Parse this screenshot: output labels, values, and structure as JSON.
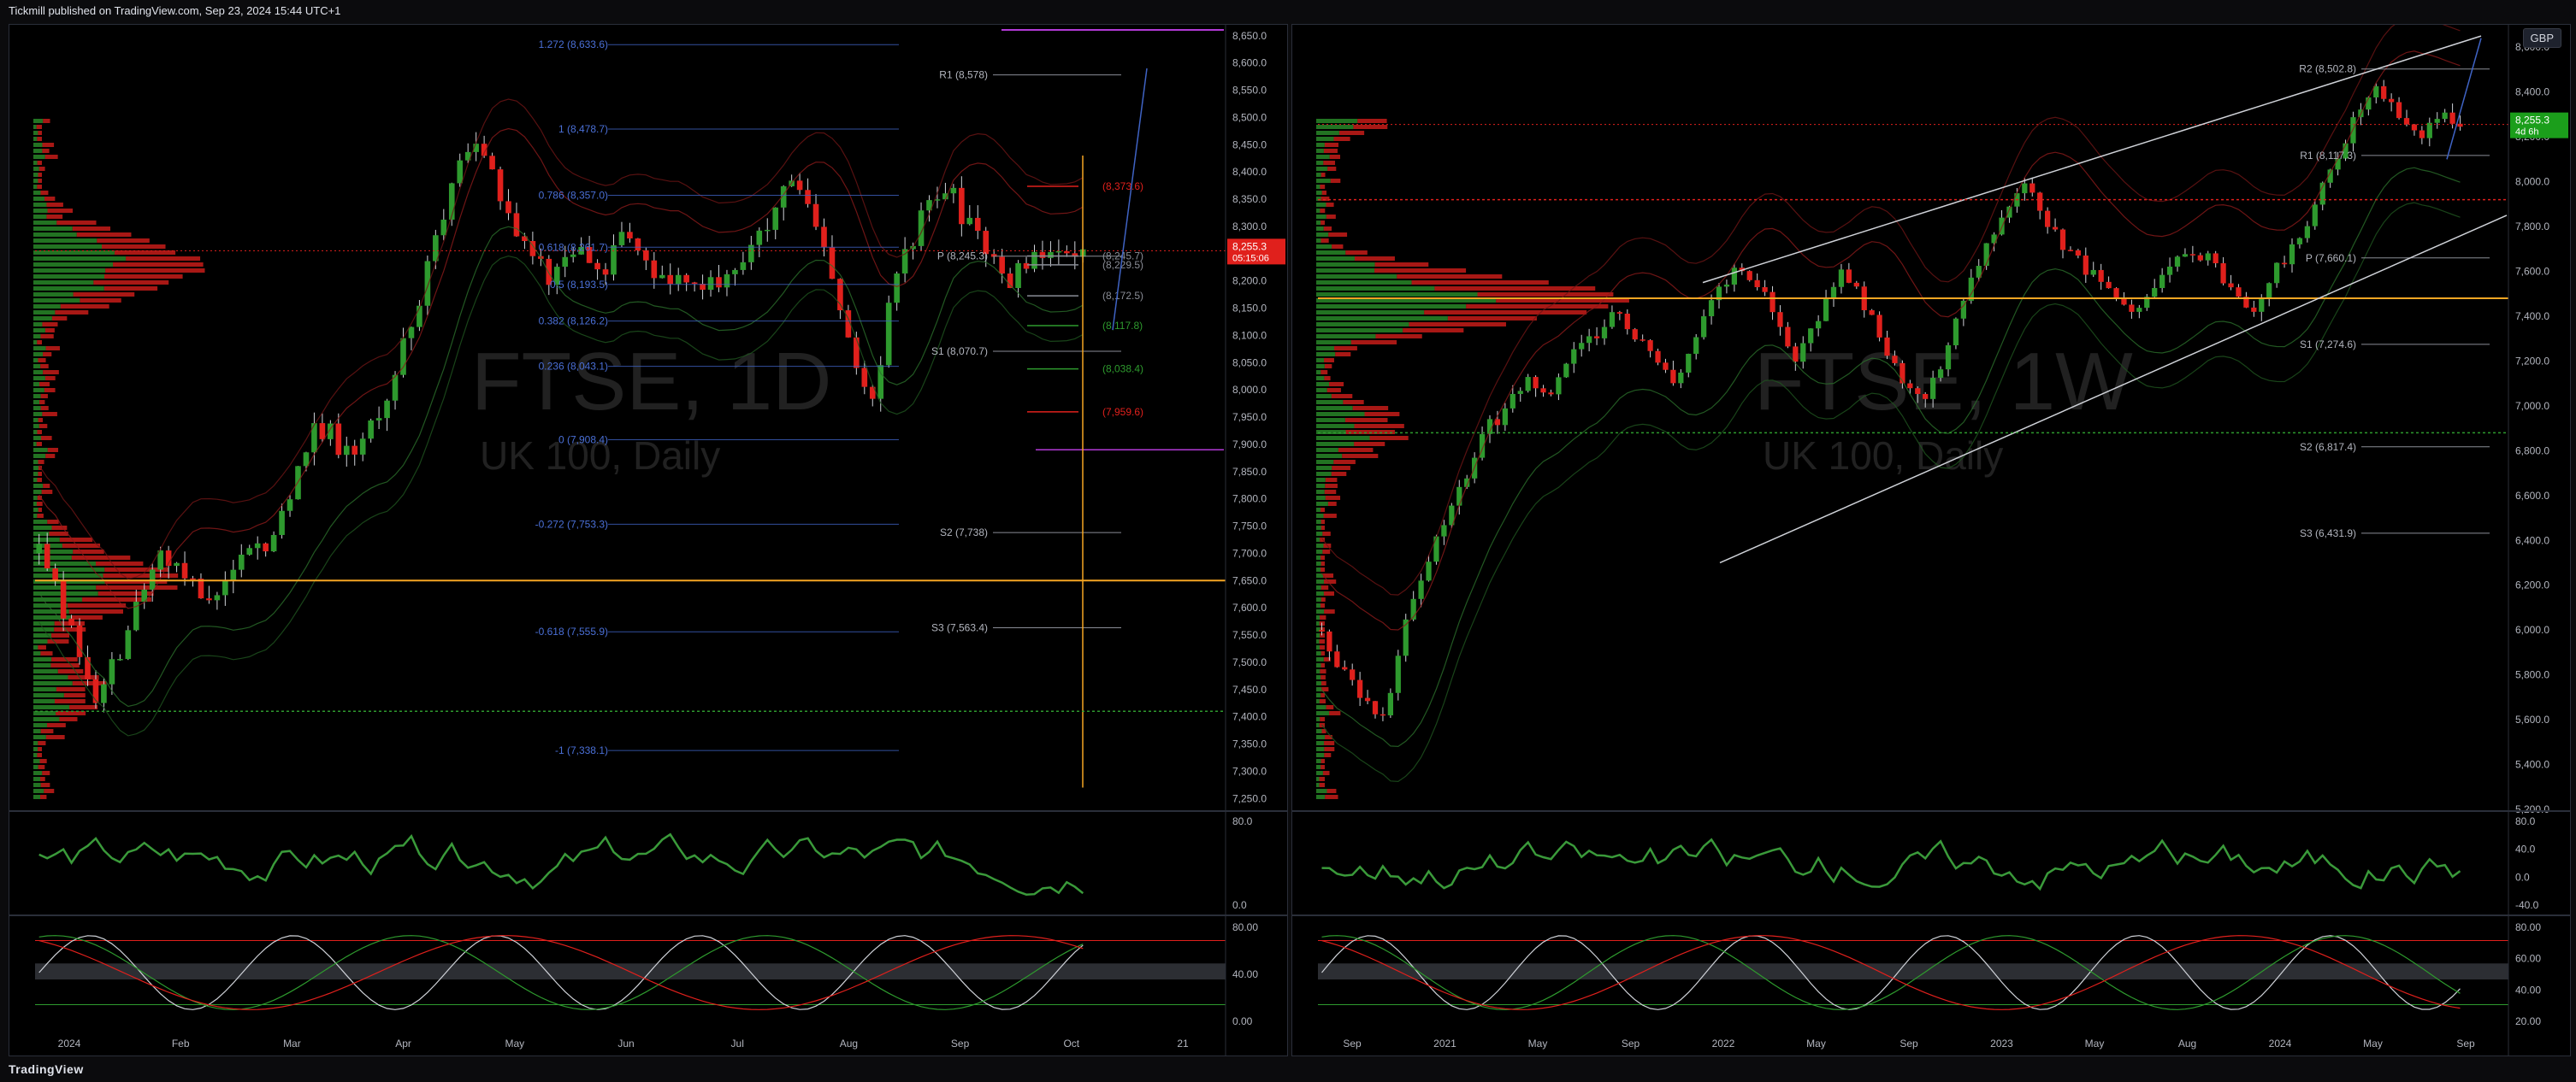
{
  "header": {
    "publisher_line": "Tickmill published on TradingView.com, Sep 23, 2024 15:44 UTC+1"
  },
  "footer": {
    "logo_text": "TradingView"
  },
  "colors": {
    "up": "#2e9a2e",
    "down": "#e0201c",
    "orange": "#f5a623",
    "fib_blue": "#3f63c4",
    "purple": "#b23ad6",
    "grid": "#1a1d24"
  },
  "left_chart": {
    "watermark_symbol": "FTSE, 1D",
    "watermark_desc": "UK 100, Daily",
    "price_axis": [
      "8,650.0",
      "8,600.0",
      "8,550.0",
      "8,500.0",
      "8,450.0",
      "8,400.0",
      "8,350.0",
      "8,300.0",
      "8,250.0",
      "8,200.0",
      "8,150.0",
      "8,100.0",
      "8,050.0",
      "8,000.0",
      "7,950.0",
      "7,900.0",
      "7,850.0",
      "7,800.0",
      "7,750.0",
      "7,700.0",
      "7,650.0",
      "7,600.0",
      "7,550.0",
      "7,500.0",
      "7,450.0",
      "7,400.0",
      "7,350.0",
      "7,300.0",
      "7,250.0"
    ],
    "time_axis": [
      "2024",
      "Feb",
      "Mar",
      "Apr",
      "May",
      "Jun",
      "Jul",
      "Aug",
      "Sep",
      "Oct",
      "21"
    ],
    "current_price": "8,255.3",
    "countdown": "05:15:06",
    "fib_labels": [
      "1.272 (8,633.6)",
      "1 (8,478.7)",
      "0.786 (8,357.0)",
      "0.618 (8,261.7)",
      "0.5 (8,193.5)",
      "0.382 (8,126.2)",
      "0.236 (8,043.1)",
      "0 (7,908.4)",
      "-0.272 (7,753.3)",
      "-0.618 (7,555.9)",
      "-1 (7,338.1)"
    ],
    "pivot_labels": [
      "R1 (8,578)",
      "P (8,245.3)",
      "S1 (8,070.7)",
      "S2 (7,738)",
      "S3 (7,563.4)"
    ],
    "level_labels": [
      "(8,373.6)",
      "(8,245.7)",
      "(8,229.5)",
      "(8,172.5)",
      "(8,117.8)",
      "(8,038.4)",
      "(7,959.6)"
    ],
    "osc1_axis": [
      "80.0",
      "0.0"
    ],
    "osc2_axis": [
      "80.00",
      "40.00",
      "0.00"
    ]
  },
  "right_chart": {
    "watermark_symbol": "FTSE, 1W",
    "watermark_desc": "UK 100, Daily",
    "currency_button": "GBP",
    "price_axis": [
      "8,600.0",
      "8,400.0",
      "8,200.0",
      "8,000.0",
      "7,800.0",
      "7,600.0",
      "7,400.0",
      "7,200.0",
      "7,000.0",
      "6,800.0",
      "6,600.0",
      "6,400.0",
      "6,200.0",
      "6,000.0",
      "5,800.0",
      "5,600.0",
      "5,400.0",
      "5,200.0"
    ],
    "time_axis": [
      "Sep",
      "2021",
      "May",
      "Sep",
      "2022",
      "May",
      "Sep",
      "2023",
      "May",
      "Aug",
      "2024",
      "May",
      "Sep"
    ],
    "current_price": "8,255.3",
    "countdown": "4d 6h",
    "pivot_labels": [
      "R2 (8,502.8)",
      "R1 (8,117.3)",
      "P (7,660.1)",
      "S1 (7,274.6)",
      "S2 (6,817.4)",
      "S3 (6,431.9)"
    ],
    "osc1_axis": [
      "80.0",
      "40.0",
      "0.0",
      "-40.0"
    ],
    "osc2_axis": [
      "80.00",
      "60.00",
      "40.00",
      "20.00"
    ]
  },
  "chart_data": [
    {
      "type": "candlestick",
      "title": "FTSE, 1D",
      "ylim": [
        7230,
        8670
      ],
      "x_ticks": [
        "2024",
        "Feb",
        "Mar",
        "Apr",
        "May",
        "Jun",
        "Jul",
        "Aug",
        "Sep",
        "Oct",
        "21"
      ],
      "close_path": [
        7700,
        7640,
        7560,
        7480,
        7430,
        7500,
        7560,
        7640,
        7700,
        7680,
        7650,
        7620,
        7640,
        7670,
        7700,
        7720,
        7760,
        7860,
        7920,
        7930,
        7890,
        7880,
        7940,
        8000,
        8080,
        8150,
        8250,
        8340,
        8420,
        8440,
        8400,
        8330,
        8270,
        8240,
        8200,
        8260,
        8240,
        8200,
        8260,
        8280,
        8230,
        8200,
        8190,
        8200,
        8180,
        8210,
        8230,
        8260,
        8290,
        8350,
        8380,
        8320,
        8240,
        8150,
        8040,
        7950,
        8130,
        8260,
        8290,
        8360,
        8380,
        8320,
        8280,
        8240,
        8200,
        8230,
        8260,
        8230,
        8250,
        8255
      ],
      "levels": {
        "R1": 8578,
        "P": 8245.3,
        "S1": 8070.7,
        "S2": 7738,
        "S3": 7563.4,
        "orange": 7650,
        "current": 8255.3
      },
      "fib": [
        8633.6,
        8478.7,
        8357.0,
        8261.7,
        8193.5,
        8126.2,
        8043.1,
        7908.4,
        7753.3,
        7555.9,
        7338.1
      ]
    },
    {
      "type": "candlestick",
      "title": "FTSE, 1W",
      "ylim": [
        5200,
        8700
      ],
      "x_ticks": [
        "Sep",
        "2021",
        "May",
        "Sep",
        "2022",
        "May",
        "Sep",
        "2023",
        "May",
        "Aug",
        "2024",
        "May",
        "Sep"
      ],
      "close_path": [
        6000,
        5800,
        5700,
        5600,
        6000,
        6300,
        6500,
        6700,
        6900,
        7000,
        7100,
        7050,
        7200,
        7300,
        7400,
        7350,
        7200,
        7100,
        7300,
        7500,
        7600,
        7550,
        7400,
        7200,
        7400,
        7600,
        7500,
        7300,
        7100,
        7000,
        7200,
        7500,
        7700,
        7900,
        8000,
        7800,
        7700,
        7600,
        7500,
        7400,
        7500,
        7600,
        7700,
        7650,
        7500,
        7400,
        7600,
        7700,
        7900,
        8100,
        8300,
        8400,
        8300,
        8200,
        8300,
        8255
      ],
      "levels": {
        "R2": 8502.8,
        "R1": 8117.3,
        "P": 7660.1,
        "S1": 7274.6,
        "S2": 6817.4,
        "S3": 6431.9,
        "orange": 7480,
        "current": 8255.3
      }
    }
  ]
}
